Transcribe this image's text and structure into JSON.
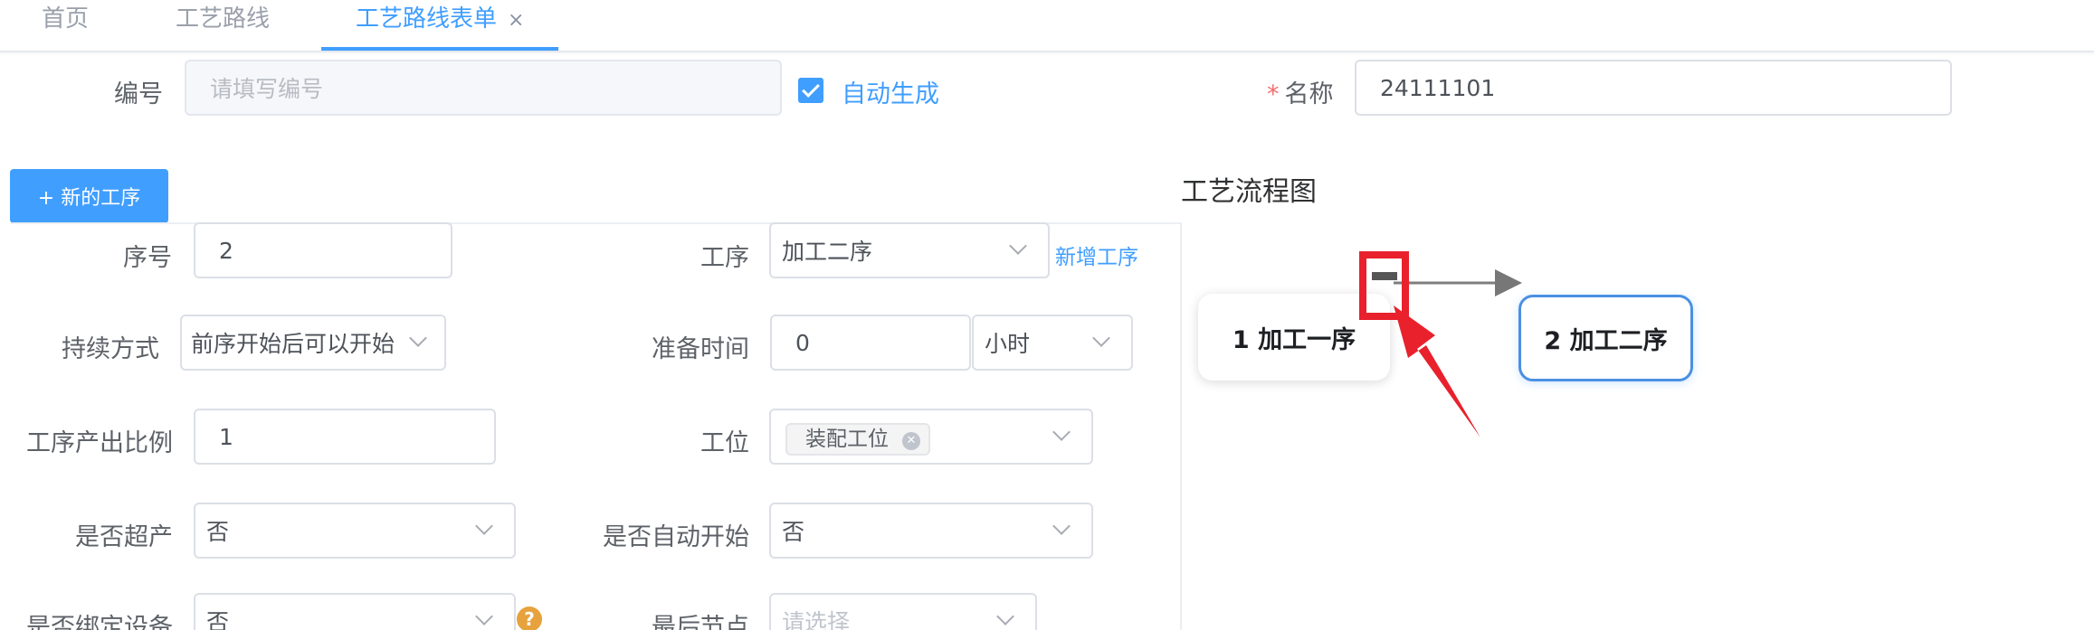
{
  "tabs": [
    {
      "label": "首页"
    },
    {
      "label": "工艺路线"
    },
    {
      "label": "工艺路线表单",
      "close": "×"
    }
  ],
  "form": {
    "code_label": "编号",
    "code_placeholder": "请填写编号",
    "auto_label": "自动生成",
    "name_required": "*",
    "name_label": "名称",
    "name_value": "24111101"
  },
  "new_process_button": "+ 新的工序",
  "process": {
    "seq_label": "序号",
    "seq_value": "2",
    "process_label": "工序",
    "process_value": "加工二序",
    "add_process_link": "新增工序",
    "duration_label": "持续方式",
    "duration_value": "前序开始后可以开始",
    "prep_label": "准备时间",
    "prep_value": "0",
    "prep_unit": "小时",
    "ratio_label": "工序产出比例",
    "ratio_value": "1",
    "station_label": "工位",
    "station_tag": "装配工位",
    "overproduce_label": "是否超产",
    "overproduce_value": "否",
    "autostart_label": "是否自动开始",
    "autostart_value": "否",
    "bind_device_label": "是否绑定设备",
    "bind_device_value": "否",
    "help_icon_text": "?",
    "last_node_label": "最后节点",
    "last_node_placeholder": "请选择"
  },
  "flow": {
    "title": "工艺流程图",
    "nodes": [
      {
        "label": "1 加工一序"
      },
      {
        "label": "2 加工二序"
      }
    ]
  },
  "colors": {
    "primary": "#409eff",
    "required": "#f56c6c",
    "annotation": "#e8212c",
    "help": "#e6a23c"
  }
}
